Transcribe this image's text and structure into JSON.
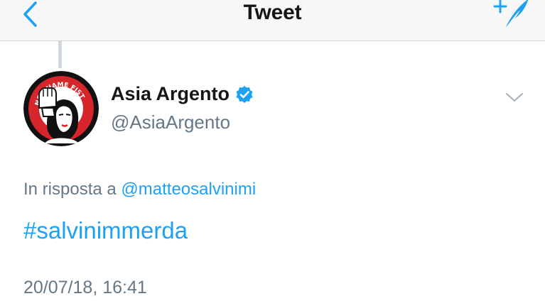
{
  "navbar": {
    "title": "Tweet",
    "back_icon": "chevron-left-icon",
    "compose_icon": "compose-tweet-icon"
  },
  "tweet": {
    "author": {
      "display_name": "Asia Argento",
      "handle": "@AsiaArgento",
      "verified": true,
      "avatar_text": "NO SHAME FIST"
    },
    "reply_prefix": "In risposta a",
    "reply_to": "@matteosalvinimi",
    "text": "#salvinimmerda",
    "timestamp": "20/07/18, 16:41"
  },
  "colors": {
    "accent": "#1da1f2",
    "secondary_text": "#657786",
    "primary_text": "#14171a",
    "navbar_bg": "#f7f7f7",
    "avatar_ring": "#d7262b"
  }
}
